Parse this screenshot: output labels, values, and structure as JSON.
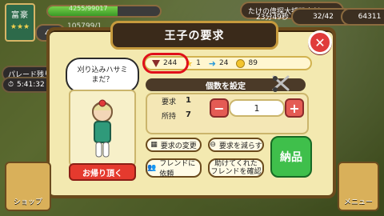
{
  "hud": {
    "badge_text": "富豪",
    "level": "46",
    "top_value": "4255/99017",
    "top_value2": "105799/1",
    "event_text": "たけの偉探大捕獲表彰",
    "event_timer": "23分49秒",
    "bag_count": "32/42",
    "coins": "64311",
    "left_banner_text": "パレード残り",
    "left_timer": "5:41:32"
  },
  "modal": {
    "title": "王子の要求",
    "speech": "刈り込みハサミ\nまだ？",
    "leave_button": "お帰り頂く",
    "stats": {
      "a": "244",
      "b": "1",
      "c": "24",
      "d": "89"
    },
    "set_count_label": "個数を設定",
    "labels": {
      "request": "要求",
      "owned": "所持"
    },
    "values": {
      "request": "1",
      "owned": "7",
      "quantity": "1"
    },
    "buttons": {
      "change": "要求の変更",
      "reduce": "要求を減らす",
      "friend": "フレンドに依頼",
      "confirm": "助けてくれた\nフレンドを確認",
      "deliver": "納品"
    }
  },
  "bottom": {
    "shop": "ショップ",
    "menu": "メニュー"
  }
}
